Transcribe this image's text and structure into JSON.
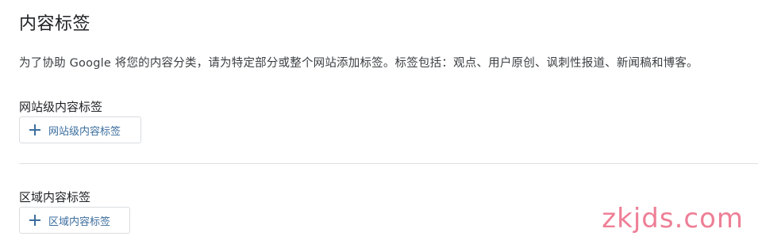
{
  "page": {
    "title": "内容标签",
    "description": "为了协助 Google 将您的内容分类，请为特定部分或整个网站添加标签。标签包括：观点、用户原创、讽刺性报道、新闻稿和博客。"
  },
  "site_section": {
    "title": "网站级内容标签",
    "button_label": "网站级内容标签",
    "button_icon": "plus-icon"
  },
  "region_section": {
    "title": "区域内容标签",
    "button_label": "区域内容标签",
    "button_icon": "plus-icon"
  },
  "watermark": {
    "text": "zkjds.com",
    "color": "#ee7f96"
  },
  "colors": {
    "accent": "#3c6e9e",
    "border": "#dadce0"
  }
}
